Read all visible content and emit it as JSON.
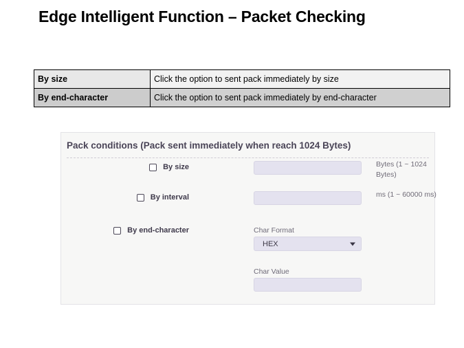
{
  "slide": {
    "title": "Edge Intelligent Function – Packet Checking"
  },
  "description_table": {
    "rows": [
      {
        "term": "By size",
        "description": "Click the option to sent pack immediately by size"
      },
      {
        "term": "By end-character",
        "description": "Click the option to sent pack immediately by end-character"
      }
    ]
  },
  "panel": {
    "title": "Pack conditions (Pack sent immediately when reach 1024 Bytes)",
    "rows": [
      {
        "label": "By size",
        "checked": false,
        "value": "",
        "helper": "Bytes (1 ~ 1024 Bytes)"
      },
      {
        "label": "By interval",
        "checked": false,
        "value": "",
        "helper": "ms (1 ~ 60000 ms)"
      },
      {
        "label": "By end-character",
        "checked": false
      }
    ],
    "char_format": {
      "label": "Char Format",
      "value": "HEX",
      "options": [
        "HEX"
      ]
    },
    "char_value": {
      "label": "Char Value",
      "value": ""
    }
  },
  "colors": {
    "panel_background": "#f7f7f6",
    "field_background": "#e4e2ef",
    "title_text": "#4a4457",
    "table_row_alt": "#d0d0d0"
  }
}
